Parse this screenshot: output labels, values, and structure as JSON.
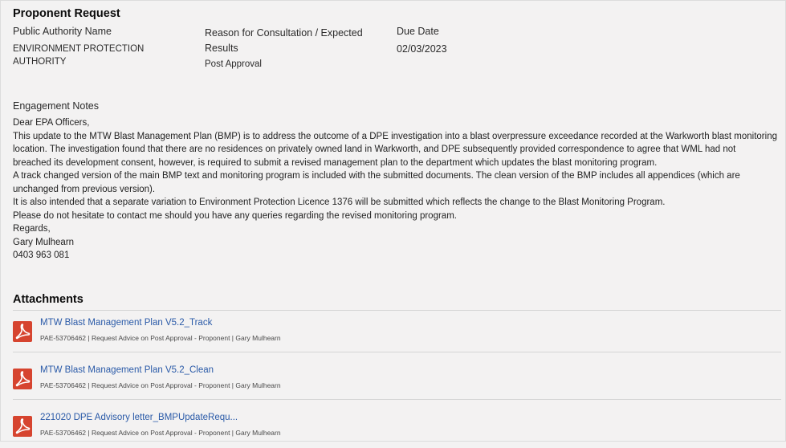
{
  "proponent_request": {
    "heading": "Proponent Request",
    "authority_label": "Public Authority Name",
    "authority_value_line1": "ENVIRONMENT PROTECTION",
    "authority_value_line2": "AUTHORITY",
    "reason_label_line1": "Reason for Consultation / Expected",
    "reason_label_line2": "Results",
    "reason_value": "Post Approval",
    "due_label": "Due Date",
    "due_value": "02/03/2023"
  },
  "engagement": {
    "label": "Engagement Notes",
    "lines": [
      "Dear EPA Officers,",
      "This update to the MTW Blast Management Plan (BMP) is to address the outcome of a DPE investigation into a blast overpressure exceedance recorded at the Warkworth blast monitoring",
      "location.  The investigation found that there are no residences on privately owned land in Warkworth, and DPE subsequently provided correspondence to agree that WML had not",
      "breached its development consent, however, is required to submit a revised management plan to the department which updates the blast monitoring program.",
      "A track changed version of the main BMP text and monitoring program is included with the submitted documents.  The clean version of the BMP includes all appendices (which are",
      "unchanged from previous version).",
      "It is also intended that a separate variation to Environment Protection Licence 1376 will be submitted which reflects the change to the Blast Monitoring Program.",
      "Please do not hesitate to contact me should you have any queries regarding the revised monitoring program.",
      "Regards,",
      "Gary Mulhearn",
      "0403 963 081"
    ]
  },
  "attachments": {
    "heading": "Attachments",
    "items": [
      {
        "title": "MTW Blast Management Plan V5.2_Track",
        "meta": "PAE-53706462 | Request Advice on Post Approval - Proponent | Gary Mulhearn",
        "icon": "pdf-icon"
      },
      {
        "title": "MTW Blast Management Plan V5.2_Clean",
        "meta": "PAE-53706462 | Request Advice on Post Approval - Proponent | Gary Mulhearn",
        "icon": "pdf-icon"
      },
      {
        "title": "221020 DPE Advisory letter_BMPUpdateRequ...",
        "meta": "PAE-53706462 | Request Advice on Post Approval - Proponent | Gary Mulhearn",
        "icon": "pdf-icon"
      }
    ]
  },
  "colors": {
    "background": "#f3f2f2",
    "link": "#2a5aa8",
    "pdf_icon": "#d6442f"
  }
}
